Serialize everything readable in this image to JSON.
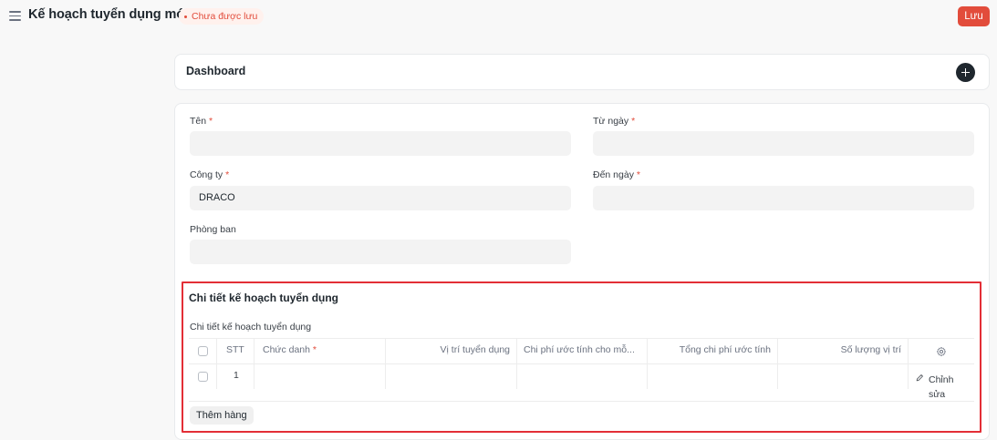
{
  "header": {
    "title": "Kế hoạch tuyển dụng mới",
    "status": "Chưa được lưu",
    "save_label": "Lưu"
  },
  "dashboard": {
    "title": "Dashboard"
  },
  "form": {
    "ten_label": "Tên",
    "ten_value": "",
    "tu_ngay_label": "Từ ngày",
    "tu_ngay_value": "",
    "cong_ty_label": "Công ty",
    "cong_ty_value": "DRACO",
    "den_ngay_label": "Đến ngày",
    "den_ngay_value": "",
    "phong_ban_label": "Phòng ban",
    "phong_ban_value": "",
    "required_mark": "*"
  },
  "section": {
    "title": "Chi tiết kế hoạch tuyển dụng",
    "table_label": "Chi tiết kế hoạch tuyển dụng",
    "columns": {
      "stt": "STT",
      "chuc_danh": "Chức danh",
      "vi_tri": "Vị trí tuyển dụng",
      "chi_phi": "Chi phí ước tính cho mỗ...",
      "tong_chi_phi": "Tổng chi phí ước tính",
      "so_luong": "Số lượng vị trí"
    },
    "rows": [
      {
        "stt": "1",
        "edit_label": "Chỉnh sửa"
      }
    ],
    "add_row_label": "Thêm hàng"
  },
  "icons": {
    "menu": "hamburger-menu-icon",
    "add": "plus-circle-icon",
    "settings": "gear-icon",
    "edit": "pencil-icon"
  },
  "colors": {
    "accent": "#e24c3b",
    "highlight_border": "#e32e36",
    "dark": "#1f272e"
  }
}
